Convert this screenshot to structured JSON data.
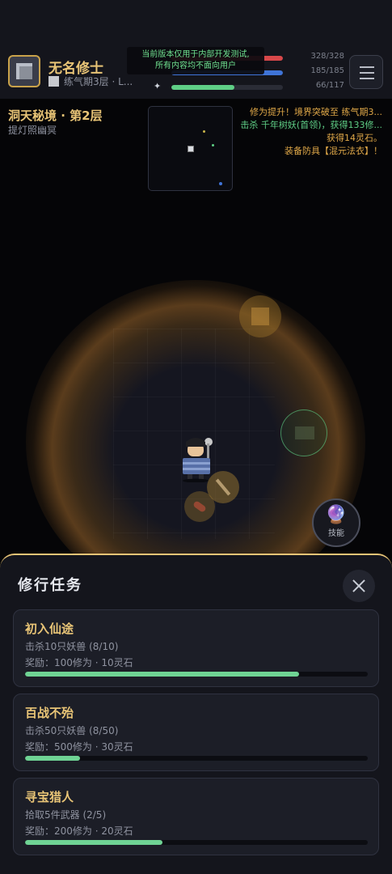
{
  "player": {
    "name": "无名修士",
    "realm": "练气期3层 · L..."
  },
  "bars": [
    {
      "icon": "heart-icon",
      "value": "328/328",
      "fraction": 1.0,
      "color": "#d9484a"
    },
    {
      "icon": "mana-icon",
      "value": "185/185",
      "fraction": 1.0,
      "color": "#3f74d8"
    },
    {
      "icon": "cultivation-icon",
      "glyph": "✦",
      "value": "66/117",
      "fraction": 0.564,
      "color": "#5fcf86"
    }
  ],
  "notice": {
    "line1": "当前版本仅用于内部开发测试,",
    "line2": "所有内容均不面向用户"
  },
  "dungeon": {
    "title": "洞天秘境 · 第2层",
    "subtitle": "提灯照幽冥"
  },
  "log": [
    {
      "text": "修为提升！境界突破至 练气期3...",
      "color": "#e0a848"
    },
    {
      "text": "击杀 千年树妖(首领)，获得133修...",
      "color": "#5fcf86"
    },
    {
      "text": "获得14灵石。",
      "color": "#e0a848"
    },
    {
      "text": "装备防具【混元法衣】！",
      "color": "#e0a848"
    }
  ],
  "skill_button": {
    "icon": "crystal-ball-icon",
    "glyph": "🔮",
    "label": "技能"
  },
  "quests_panel": {
    "title": "修行任务",
    "quests": [
      {
        "name": "初入仙途",
        "desc": "击杀10只妖兽 (8/10)",
        "reward": "奖励：100修为 · 10灵石",
        "progress": 0.8
      },
      {
        "name": "百战不殆",
        "desc": "击杀50只妖兽 (8/50)",
        "reward": "奖励：500修为 · 30灵石",
        "progress": 0.16
      },
      {
        "name": "寻宝猎人",
        "desc": "拾取5件武器 (2/5)",
        "reward": "奖励：200修为 · 20灵石",
        "progress": 0.4
      }
    ]
  }
}
